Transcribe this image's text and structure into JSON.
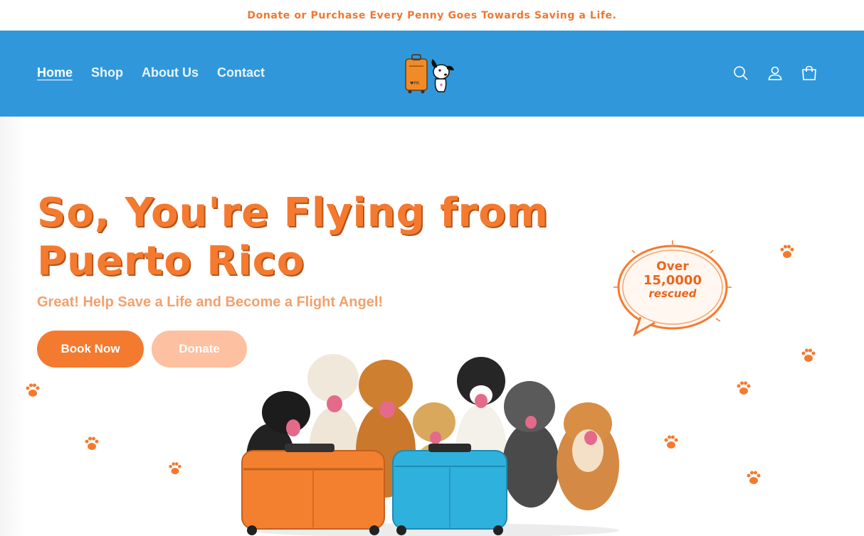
{
  "announcement": "Donate or Purchase Every Penny Goes Towards Saving a Life.",
  "nav": {
    "items": [
      {
        "label": "Home",
        "active": true
      },
      {
        "label": "Shop",
        "active": false
      },
      {
        "label": "About Us",
        "active": false
      },
      {
        "label": "Contact",
        "active": false
      }
    ]
  },
  "header_icons": [
    "search-icon",
    "account-icon",
    "cart-icon"
  ],
  "hero": {
    "title_line1": "So, You're Flying from",
    "title_line2": "Puerto Rico",
    "subtitle": "Great! Help Save a Life and Become a Flight Angel!",
    "book_label": "Book Now",
    "donate_label": "Donate",
    "badge_line1": "Over",
    "badge_line2": "15,0000",
    "badge_line3": "rescued"
  },
  "colors": {
    "brand_orange": "#f47a2f",
    "header_blue": "#3098da",
    "donate_light": "#fdc0a0",
    "subtitle_orange": "#f3a06c"
  }
}
